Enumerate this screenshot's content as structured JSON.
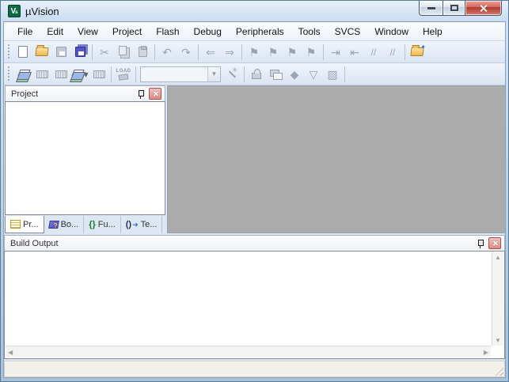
{
  "window": {
    "title": "µVision"
  },
  "menu": {
    "items": [
      "File",
      "Edit",
      "View",
      "Project",
      "Flash",
      "Debug",
      "Peripherals",
      "Tools",
      "SVCS",
      "Window",
      "Help"
    ]
  },
  "toolbar_file": {
    "glyphs": {
      "cut": "✂",
      "undo": "↶",
      "redo": "↷",
      "back": "⇐",
      "forward": "⇒",
      "bookmark": "⚑",
      "indent": "⇥",
      "unindent": "⇤",
      "comment": "//",
      "uncomment": "//"
    }
  },
  "toolbar_build": {
    "load_label": "LOAD",
    "target_select": {
      "value": ""
    },
    "glyphs": {
      "dropdown": "▾",
      "rte": "◆",
      "filter": "▽",
      "pack": "▨",
      "sparkle": "✦"
    }
  },
  "project_panel": {
    "title": "Project",
    "tabs": [
      {
        "label": "Pr..."
      },
      {
        "label": "Bo..."
      },
      {
        "label": "Fu...",
        "glyph": "{}"
      },
      {
        "label": "Te...",
        "glyph": "()",
        "arrow": "➜"
      }
    ]
  },
  "build_output": {
    "title": "Build Output",
    "content": ""
  },
  "status_bar": {
    "text": ""
  },
  "scrollbar": {
    "up": "▲",
    "down": "▼",
    "left": "◀",
    "right": "▶"
  }
}
